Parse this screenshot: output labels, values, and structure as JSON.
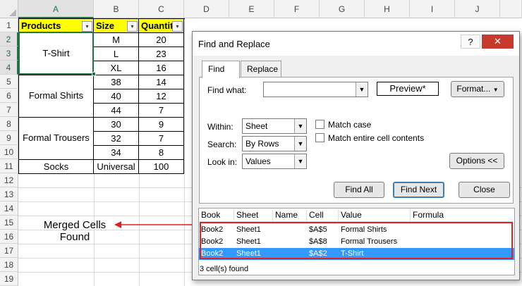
{
  "spreadsheet": {
    "columns": [
      "A",
      "B",
      "C",
      "D",
      "E",
      "F",
      "G",
      "H",
      "I",
      "J"
    ],
    "rows": [
      "1",
      "2",
      "3",
      "4",
      "5",
      "6",
      "7",
      "8",
      "9",
      "10",
      "11",
      "12",
      "13",
      "14",
      "15",
      "16",
      "17",
      "18",
      "19"
    ],
    "headers": {
      "products": "Products",
      "size": "Size",
      "quantity": "Quantit"
    },
    "product_groups": [
      "T-Shirt",
      "Formal Shirts",
      "Formal Trousers",
      "Socks"
    ],
    "sizes": [
      "M",
      "L",
      "XL",
      "38",
      "40",
      "44",
      "30",
      "32",
      "34",
      "Universal"
    ],
    "quantities": [
      "20",
      "23",
      "16",
      "14",
      "12",
      "7",
      "9",
      "7",
      "8",
      "100"
    ],
    "filter_icon": "▾"
  },
  "annotation": {
    "line1": "Merged Cells",
    "line2": "Found"
  },
  "dialog": {
    "title": "Find and Replace",
    "help_label": "?",
    "close_label": "✕",
    "tabs": [
      {
        "label": "Find"
      },
      {
        "label": "Replace"
      }
    ],
    "find_what_label": "Find what:",
    "find_what_value": "",
    "preview_label": "Preview*",
    "format_label": "Format...",
    "within_label": "Within:",
    "within_value": "Sheet",
    "search_label": "Search:",
    "search_value": "By Rows",
    "lookin_label": "Look in:",
    "lookin_value": "Values",
    "match_case_label": "Match case",
    "match_entire_label": "Match entire cell contents",
    "options_label": "Options <<",
    "find_all_label": "Find All",
    "find_next_label": "Find Next",
    "close_button_label": "Close",
    "result_columns": [
      "Book",
      "Sheet",
      "Name",
      "Cell",
      "Value",
      "Formula"
    ],
    "results": [
      {
        "book": "Book2",
        "sheet": "Sheet1",
        "name": "",
        "cell": "$A$5",
        "value": "Formal Shirts",
        "formula": ""
      },
      {
        "book": "Book2",
        "sheet": "Sheet1",
        "name": "",
        "cell": "$A$8",
        "value": "Formal Trousers",
        "formula": ""
      },
      {
        "book": "Book2",
        "sheet": "Sheet1",
        "name": "",
        "cell": "$A$2",
        "value": "T-Shirt",
        "formula": ""
      }
    ],
    "status": "3 cell(s) found"
  },
  "colors": {
    "header_fill": "#ffff00",
    "selection_accent": "#217346",
    "highlight_border": "#e02020",
    "selected_row": "#3399ff"
  }
}
